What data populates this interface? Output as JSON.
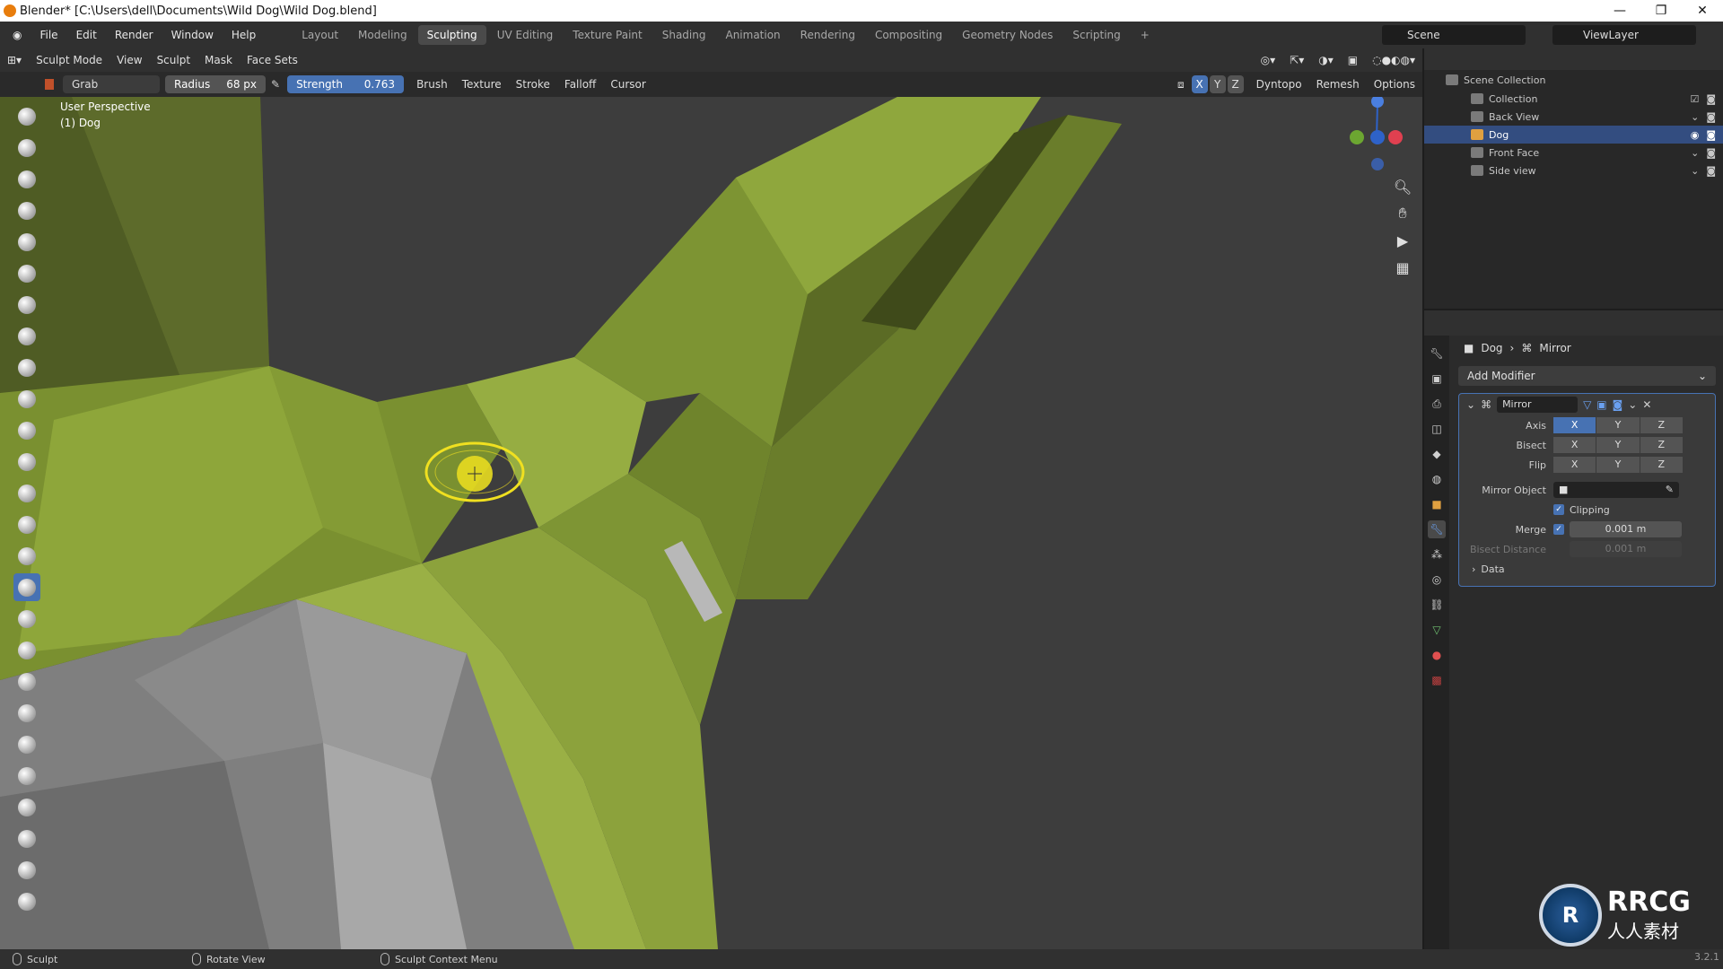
{
  "titlebar": {
    "title": "Blender* [C:\\Users\\dell\\Documents\\Wild Dog\\Wild Dog.blend]",
    "minimize": "—",
    "maximize": "❐",
    "close": "✕"
  },
  "menubar": {
    "menus": [
      "File",
      "Edit",
      "Render",
      "Window",
      "Help"
    ],
    "workspaces": [
      "Layout",
      "Modeling",
      "Sculpting",
      "UV Editing",
      "Texture Paint",
      "Shading",
      "Animation",
      "Rendering",
      "Compositing",
      "Geometry Nodes",
      "Scripting"
    ],
    "active_workspace": "Sculpting",
    "add_workspace": "+",
    "scene": "Scene",
    "view_layer": "ViewLayer"
  },
  "vp_header": {
    "mode": "Sculpt Mode",
    "menus": [
      "View",
      "Sculpt",
      "Mask",
      "Face Sets"
    ]
  },
  "tool_header": {
    "brush_name": "Grab",
    "radius_label": "Radius",
    "radius_value": "68 px",
    "strength_label": "Strength",
    "strength_value": "0.763",
    "dropdowns": [
      "Brush",
      "Texture",
      "Stroke",
      "Falloff",
      "Cursor"
    ],
    "axes": [
      "X",
      "Y",
      "Z"
    ],
    "dyntopo": "Dyntopo",
    "remesh": "Remesh",
    "options": "Options"
  },
  "viewport": {
    "view_name": "User Perspective",
    "object_info": "(1) Dog",
    "colors": {
      "background": "#3d3d3d",
      "mesh_green": "#8ea63a",
      "mesh_gray": "#8a8a8a",
      "brush_ring": "#f0e020"
    },
    "nav_icons": [
      "zoom-icon",
      "hand-icon",
      "camera-icon",
      "grid-icon"
    ],
    "gizmo_axes": [
      "Z"
    ]
  },
  "outliner": {
    "root": "Scene Collection",
    "items": [
      {
        "name": "Collection",
        "selected": false
      },
      {
        "name": "Back View",
        "selected": false
      },
      {
        "name": "Dog",
        "selected": true
      },
      {
        "name": "Front Face",
        "selected": false
      },
      {
        "name": "Side view",
        "selected": false
      }
    ]
  },
  "properties": {
    "breadcrumb_object": "Dog",
    "breadcrumb_modifier": "Mirror",
    "add_modifier": "Add Modifier",
    "modifier_name": "Mirror",
    "axis_label": "Axis",
    "bisect_label": "Bisect",
    "flip_label": "Flip",
    "axes": [
      "X",
      "Y",
      "Z"
    ],
    "mirror_object_label": "Mirror Object",
    "clipping_label": "Clipping",
    "merge_label": "Merge",
    "merge_value": "0.001 m",
    "bisect_distance_label": "Bisect Distance",
    "bisect_distance_value": "0.001 m",
    "data_label": "Data"
  },
  "statusbar": {
    "left": "Sculpt",
    "middle": "Rotate View",
    "right": "Sculpt Context Menu",
    "version": "3.2.1"
  },
  "watermark": {
    "mark": "RRCG",
    "cn": "人人素材"
  }
}
